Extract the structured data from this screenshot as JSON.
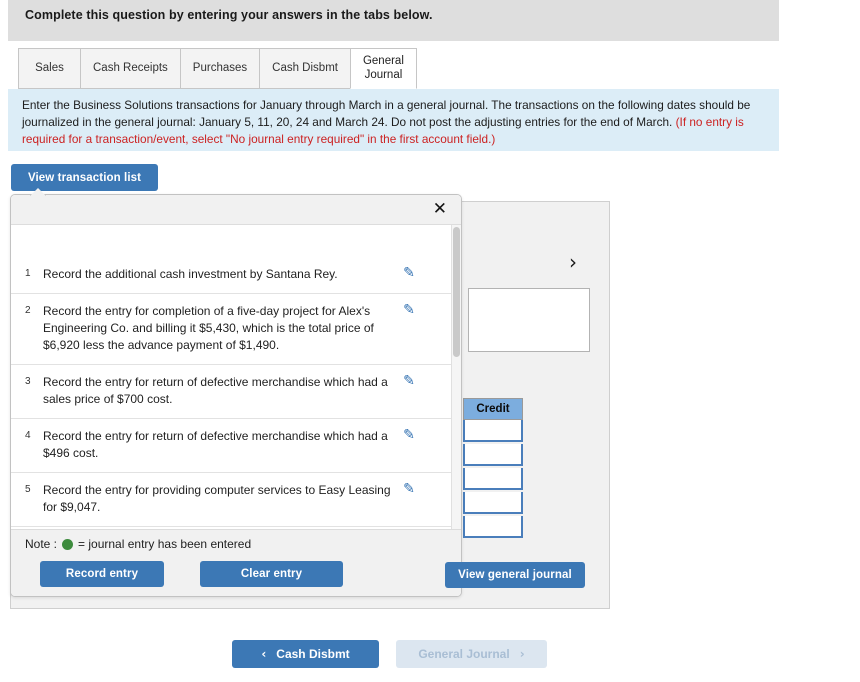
{
  "banner": {
    "title": "Complete this question by entering your answers in the tabs below."
  },
  "tabs": [
    {
      "label": "Sales",
      "active": false
    },
    {
      "label": "Cash Receipts",
      "active": false
    },
    {
      "label": "Purchases",
      "active": false
    },
    {
      "label": "Cash Disbmt",
      "active": false
    },
    {
      "label": "General\nJournal",
      "active": true
    }
  ],
  "instructions": {
    "body": "Enter the Business Solutions transactions for January through March in a general journal. The transactions on the following dates should be journalized in the general journal: January 5, 11, 20, 24 and March 24. Do not post the adjusting entries for the end of March. ",
    "warning": "(If no entry is required for a transaction/event, select \"No journal entry required\" in the first account field.)"
  },
  "toolbar": {
    "view_transaction_list": "View transaction list"
  },
  "worksheet": {
    "credit_header": "Credit",
    "credit_rows": [
      "",
      "",
      "",
      "",
      ""
    ],
    "expand_icon": "›"
  },
  "modal": {
    "close_icon": "✕",
    "transactions": [
      {
        "num": "1",
        "text": "Record the additional cash investment by Santana Rey.",
        "edit_icon": "✎"
      },
      {
        "num": "2",
        "text": "Record the entry for completion of a five-day project for Alex's Engineering Co. and billing it $5,430, which is the total price of $6,920 less the advance payment of $1,490.",
        "edit_icon": "✎"
      },
      {
        "num": "3",
        "text": "Record the entry for return of defective merchandise which had a sales price of $700 cost.",
        "edit_icon": "✎"
      },
      {
        "num": "4",
        "text": "Record the entry for return of defective merchandise which had a $496 cost.",
        "edit_icon": "✎"
      },
      {
        "num": "5",
        "text": "Record the entry for providing computer services to Easy Leasing for $9,047.",
        "edit_icon": "✎"
      }
    ],
    "note_prefix": "Note :",
    "note_text": "= journal entry has been entered",
    "record_entry": "Record entry",
    "clear_entry": "Clear entry"
  },
  "actions": {
    "view_general_journal": "View general journal"
  },
  "nav": {
    "prev_label": "Cash Disbmt",
    "prev_icon": "‹",
    "next_label": "General Journal",
    "next_icon": "›"
  },
  "colors": {
    "accent_blue": "#3c78b5",
    "banner_gray": "#dedede",
    "info_blue": "#dcedf7",
    "warning_red": "#cc2222",
    "credit_header_blue": "#7cadde",
    "entered_green": "#3d8b3d",
    "disabled_blue": "#dce6f0"
  }
}
